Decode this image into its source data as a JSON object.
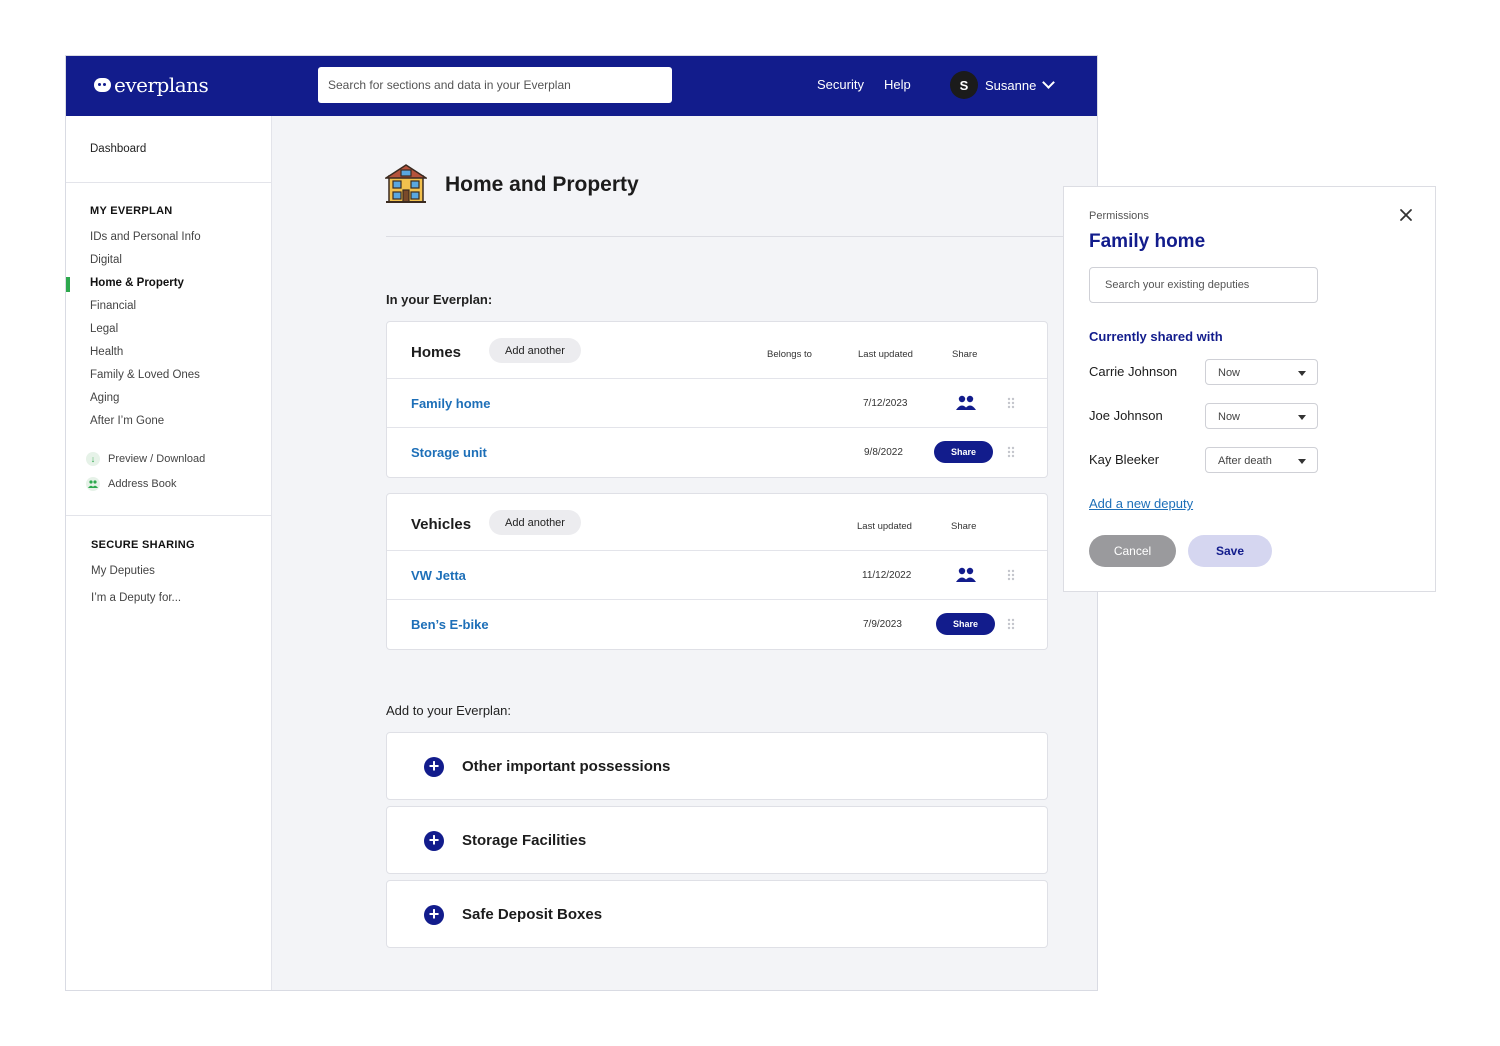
{
  "header": {
    "logo_text": "everplans",
    "search_placeholder": "Search for sections and data in your Everplan",
    "nav": [
      "Security",
      "Help"
    ],
    "user": {
      "initial": "S",
      "name": "Susanne"
    }
  },
  "sidebar": {
    "dashboard": "Dashboard",
    "my_everplan_heading": "MY EVERPLAN",
    "items": [
      "IDs and Personal Info",
      "Digital",
      "Home & Property",
      "Financial",
      "Legal",
      "Health",
      "Family & Loved Ones",
      "Aging",
      "After I’m Gone"
    ],
    "active_item": "Home & Property",
    "utilities": [
      {
        "label": "Preview / Download",
        "icon": "download-icon"
      },
      {
        "label": "Address Book",
        "icon": "people-icon"
      }
    ],
    "secure_sharing_heading": "SECURE SHARING",
    "sharing_items": [
      "My Deputies",
      "I’m a Deputy for..."
    ]
  },
  "main": {
    "page_title": "Home and Property",
    "page_icon": "house-icon",
    "in_everplan_label": "In your Everplan:",
    "homes": {
      "title": "Homes",
      "add_label": "Add another",
      "columns": {
        "belongs_to": "Belongs to",
        "last_updated": "Last updated",
        "share": "Share"
      },
      "rows": [
        {
          "name": "Family home",
          "date": "7/12/2023",
          "share": "shared-people-icon"
        },
        {
          "name": "Storage unit",
          "date": "9/8/2022",
          "share": "Share"
        }
      ]
    },
    "vehicles": {
      "title": "Vehicles",
      "add_label": "Add another",
      "columns": {
        "last_updated": "Last updated",
        "share": "Share"
      },
      "rows": [
        {
          "name": "VW Jetta",
          "date": "11/12/2022",
          "share": "shared-people-icon"
        },
        {
          "name": "Ben’s E-bike",
          "date": "7/9/2023",
          "share": "Share"
        }
      ]
    },
    "add_label": "Add to your Everplan:",
    "add_items": [
      "Other important possessions",
      "Storage Facilities",
      "Safe Deposit Boxes"
    ]
  },
  "permissions": {
    "subtitle": "Permissions",
    "title": "Family home",
    "search_placeholder": "Search your existing deputies",
    "shared_heading": "Currently shared with",
    "deputies": [
      {
        "name": "Carrie Johnson",
        "when": "Now"
      },
      {
        "name": "Joe Johnson",
        "when": "Now"
      },
      {
        "name": "Kay Bleeker",
        "when": "After death"
      }
    ],
    "add_deputy": "Add a new deputy",
    "cancel": "Cancel",
    "save": "Save"
  },
  "colors": {
    "brand_navy": "#121c8c",
    "link_blue": "#1d6fb8",
    "active_green": "#2da84d",
    "page_bg": "#f3f4f7"
  }
}
